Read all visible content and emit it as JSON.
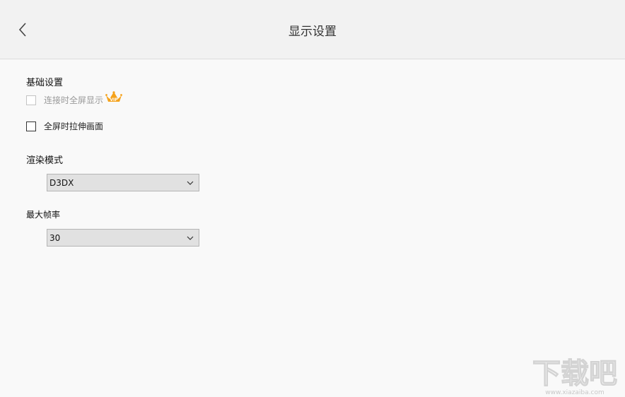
{
  "header": {
    "title": "显示设置",
    "back_icon": "chevron-left-icon"
  },
  "basic": {
    "title": "基础设置",
    "fullscreen_on_connect": {
      "label": "连接时全屏显示",
      "checked": false,
      "disabled": true,
      "badge": "VIP"
    },
    "stretch_fullscreen": {
      "label": "全屏时拉伸画面",
      "checked": false,
      "disabled": false
    }
  },
  "render": {
    "title": "渲染模式",
    "selected": "D3DX"
  },
  "framerate": {
    "title": "最大帧率",
    "selected": "30"
  },
  "watermark": {
    "text": "下载吧",
    "url": "www.xiazaiba.com"
  },
  "colors": {
    "header_bg": "#f2f2f2",
    "page_bg": "#f9f9f9",
    "select_bg": "#e1e1e1",
    "vip_orange": "#f5a21b"
  }
}
